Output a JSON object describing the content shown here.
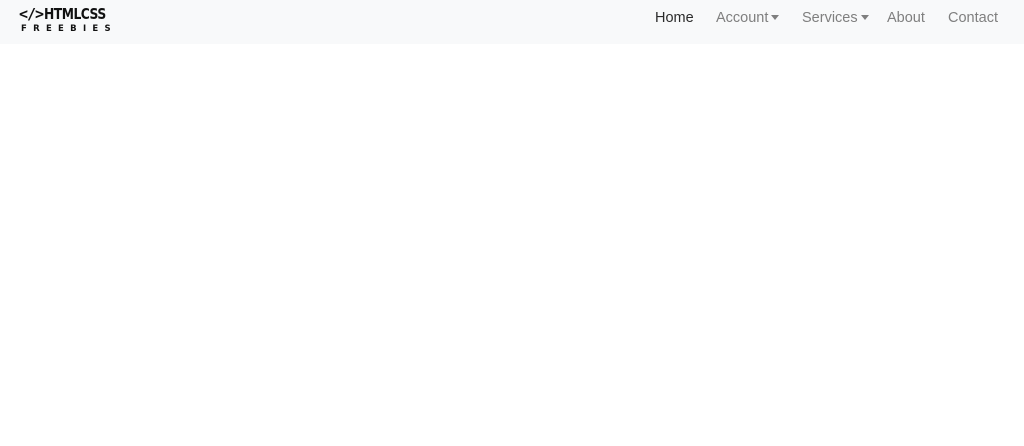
{
  "brand": {
    "code_glyph": "</>",
    "word": "HTMLCSS",
    "subtitle": "FREEBIES"
  },
  "nav": {
    "items": [
      {
        "label": "Home",
        "active": true,
        "dropdown": false
      },
      {
        "label": "Account",
        "active": false,
        "dropdown": true
      },
      {
        "label": "Services",
        "active": false,
        "dropdown": true
      },
      {
        "label": "About",
        "active": false,
        "dropdown": false
      },
      {
        "label": "Contact",
        "active": false,
        "dropdown": false
      }
    ]
  },
  "colors": {
    "navbar_bg": "#f8f9fa",
    "active_link": "#2b2b2b",
    "inactive_link": "#7f7f7f",
    "page_bg": "#ffffff"
  },
  "icons": {
    "dropdown": "caret-down-icon"
  }
}
